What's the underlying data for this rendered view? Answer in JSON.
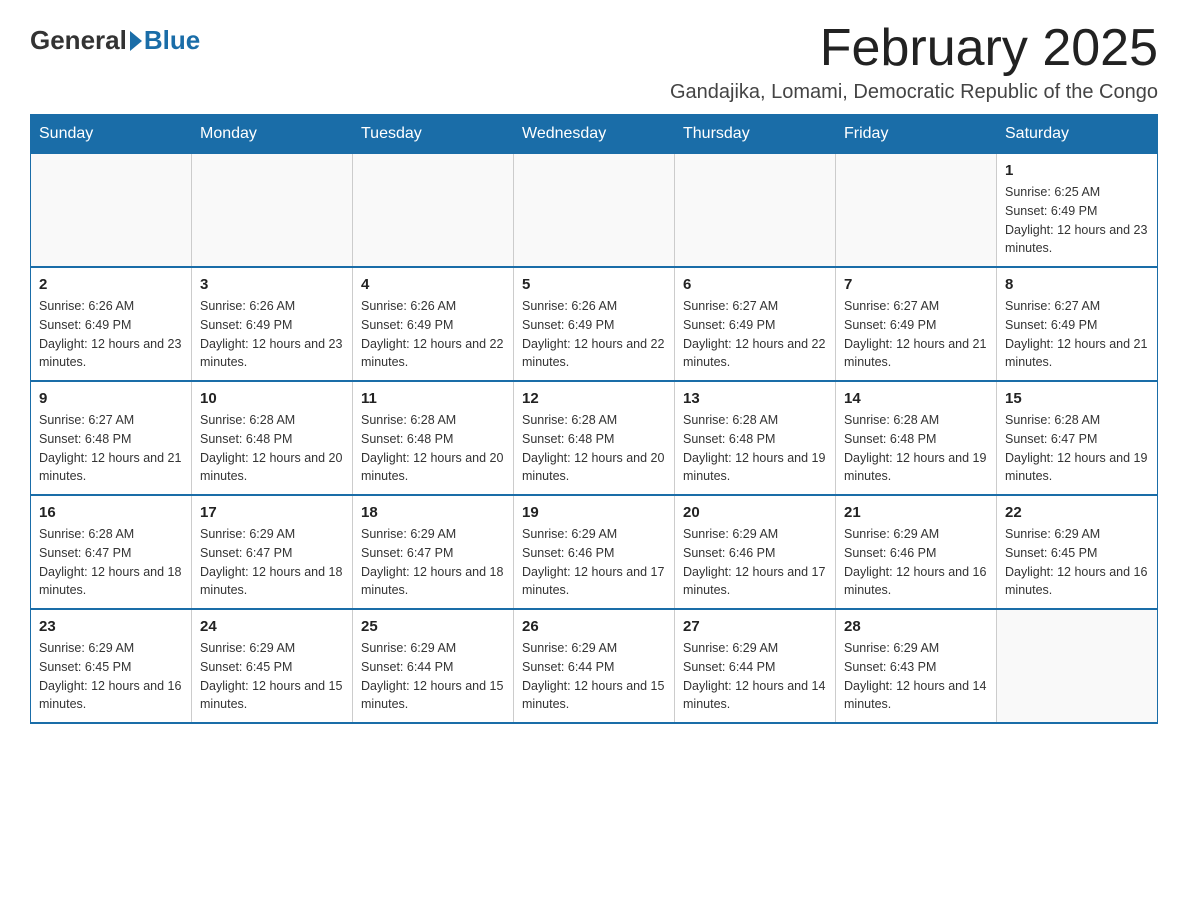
{
  "header": {
    "logo_general": "General",
    "logo_blue": "Blue",
    "month_title": "February 2025",
    "location": "Gandajika, Lomami, Democratic Republic of the Congo"
  },
  "days_of_week": [
    "Sunday",
    "Monday",
    "Tuesday",
    "Wednesday",
    "Thursday",
    "Friday",
    "Saturday"
  ],
  "weeks": [
    {
      "days": [
        {
          "number": "",
          "info": ""
        },
        {
          "number": "",
          "info": ""
        },
        {
          "number": "",
          "info": ""
        },
        {
          "number": "",
          "info": ""
        },
        {
          "number": "",
          "info": ""
        },
        {
          "number": "",
          "info": ""
        },
        {
          "number": "1",
          "info": "Sunrise: 6:25 AM\nSunset: 6:49 PM\nDaylight: 12 hours and 23 minutes."
        }
      ]
    },
    {
      "days": [
        {
          "number": "2",
          "info": "Sunrise: 6:26 AM\nSunset: 6:49 PM\nDaylight: 12 hours and 23 minutes."
        },
        {
          "number": "3",
          "info": "Sunrise: 6:26 AM\nSunset: 6:49 PM\nDaylight: 12 hours and 23 minutes."
        },
        {
          "number": "4",
          "info": "Sunrise: 6:26 AM\nSunset: 6:49 PM\nDaylight: 12 hours and 22 minutes."
        },
        {
          "number": "5",
          "info": "Sunrise: 6:26 AM\nSunset: 6:49 PM\nDaylight: 12 hours and 22 minutes."
        },
        {
          "number": "6",
          "info": "Sunrise: 6:27 AM\nSunset: 6:49 PM\nDaylight: 12 hours and 22 minutes."
        },
        {
          "number": "7",
          "info": "Sunrise: 6:27 AM\nSunset: 6:49 PM\nDaylight: 12 hours and 21 minutes."
        },
        {
          "number": "8",
          "info": "Sunrise: 6:27 AM\nSunset: 6:49 PM\nDaylight: 12 hours and 21 minutes."
        }
      ]
    },
    {
      "days": [
        {
          "number": "9",
          "info": "Sunrise: 6:27 AM\nSunset: 6:48 PM\nDaylight: 12 hours and 21 minutes."
        },
        {
          "number": "10",
          "info": "Sunrise: 6:28 AM\nSunset: 6:48 PM\nDaylight: 12 hours and 20 minutes."
        },
        {
          "number": "11",
          "info": "Sunrise: 6:28 AM\nSunset: 6:48 PM\nDaylight: 12 hours and 20 minutes."
        },
        {
          "number": "12",
          "info": "Sunrise: 6:28 AM\nSunset: 6:48 PM\nDaylight: 12 hours and 20 minutes."
        },
        {
          "number": "13",
          "info": "Sunrise: 6:28 AM\nSunset: 6:48 PM\nDaylight: 12 hours and 19 minutes."
        },
        {
          "number": "14",
          "info": "Sunrise: 6:28 AM\nSunset: 6:48 PM\nDaylight: 12 hours and 19 minutes."
        },
        {
          "number": "15",
          "info": "Sunrise: 6:28 AM\nSunset: 6:47 PM\nDaylight: 12 hours and 19 minutes."
        }
      ]
    },
    {
      "days": [
        {
          "number": "16",
          "info": "Sunrise: 6:28 AM\nSunset: 6:47 PM\nDaylight: 12 hours and 18 minutes."
        },
        {
          "number": "17",
          "info": "Sunrise: 6:29 AM\nSunset: 6:47 PM\nDaylight: 12 hours and 18 minutes."
        },
        {
          "number": "18",
          "info": "Sunrise: 6:29 AM\nSunset: 6:47 PM\nDaylight: 12 hours and 18 minutes."
        },
        {
          "number": "19",
          "info": "Sunrise: 6:29 AM\nSunset: 6:46 PM\nDaylight: 12 hours and 17 minutes."
        },
        {
          "number": "20",
          "info": "Sunrise: 6:29 AM\nSunset: 6:46 PM\nDaylight: 12 hours and 17 minutes."
        },
        {
          "number": "21",
          "info": "Sunrise: 6:29 AM\nSunset: 6:46 PM\nDaylight: 12 hours and 16 minutes."
        },
        {
          "number": "22",
          "info": "Sunrise: 6:29 AM\nSunset: 6:45 PM\nDaylight: 12 hours and 16 minutes."
        }
      ]
    },
    {
      "days": [
        {
          "number": "23",
          "info": "Sunrise: 6:29 AM\nSunset: 6:45 PM\nDaylight: 12 hours and 16 minutes."
        },
        {
          "number": "24",
          "info": "Sunrise: 6:29 AM\nSunset: 6:45 PM\nDaylight: 12 hours and 15 minutes."
        },
        {
          "number": "25",
          "info": "Sunrise: 6:29 AM\nSunset: 6:44 PM\nDaylight: 12 hours and 15 minutes."
        },
        {
          "number": "26",
          "info": "Sunrise: 6:29 AM\nSunset: 6:44 PM\nDaylight: 12 hours and 15 minutes."
        },
        {
          "number": "27",
          "info": "Sunrise: 6:29 AM\nSunset: 6:44 PM\nDaylight: 12 hours and 14 minutes."
        },
        {
          "number": "28",
          "info": "Sunrise: 6:29 AM\nSunset: 6:43 PM\nDaylight: 12 hours and 14 minutes."
        },
        {
          "number": "",
          "info": ""
        }
      ]
    }
  ]
}
